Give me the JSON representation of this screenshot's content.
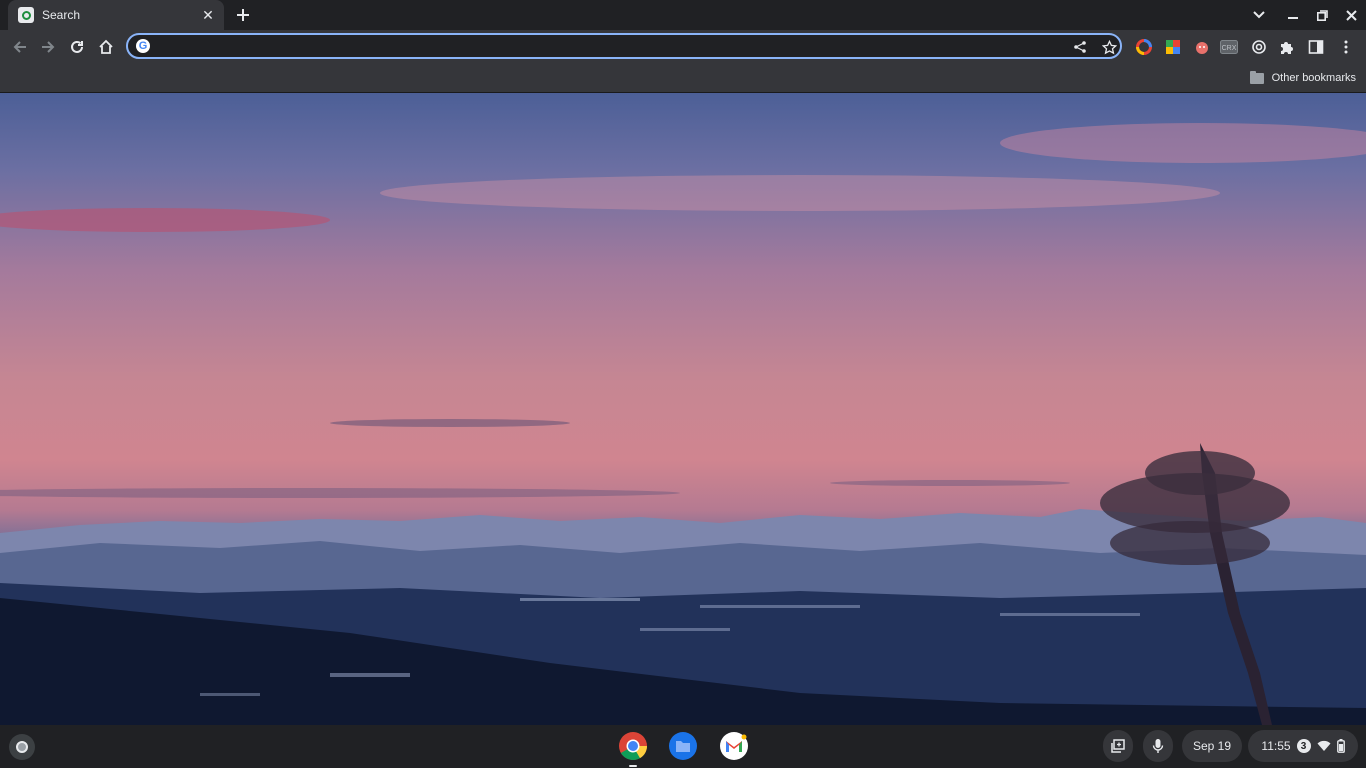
{
  "browser": {
    "tab": {
      "title": "Search",
      "favicon": "search-favicon-icon",
      "close": "close-icon"
    },
    "new_tab": "plus-icon",
    "window_controls": [
      "chevron-down-icon",
      "minimize-icon",
      "restore-icon",
      "close-icon"
    ],
    "nav": [
      "back-arrow-icon",
      "forward-arrow-icon",
      "reload-icon",
      "home-icon"
    ],
    "omnibox": {
      "value": "",
      "placeholder": "",
      "engine_icon": "google-g-icon",
      "engine_letter": "G"
    },
    "omnibox_actions": [
      "share-icon",
      "bookmark-star-icon"
    ],
    "extensions": [
      "color-picker-icon",
      "palette-icon",
      "reaction-icon",
      "crx-icon",
      "spiral-icon",
      "puzzle-icon",
      "side-panel-icon",
      "more-menu-icon"
    ],
    "bookmarks": {
      "other_label": "Other bookmarks"
    }
  },
  "colors": {
    "accent": "#8ab4f8",
    "toolbar": "#35363a",
    "frame": "#202124"
  },
  "shelf": {
    "apps": [
      "chrome-icon",
      "files-icon",
      "gmail-icon"
    ],
    "date": "Sep 19",
    "time": "11:55",
    "notification_count": "3",
    "tray_icons": [
      "screen-capture-icon",
      "microphone-icon",
      "wifi-icon",
      "battery-icon"
    ]
  }
}
